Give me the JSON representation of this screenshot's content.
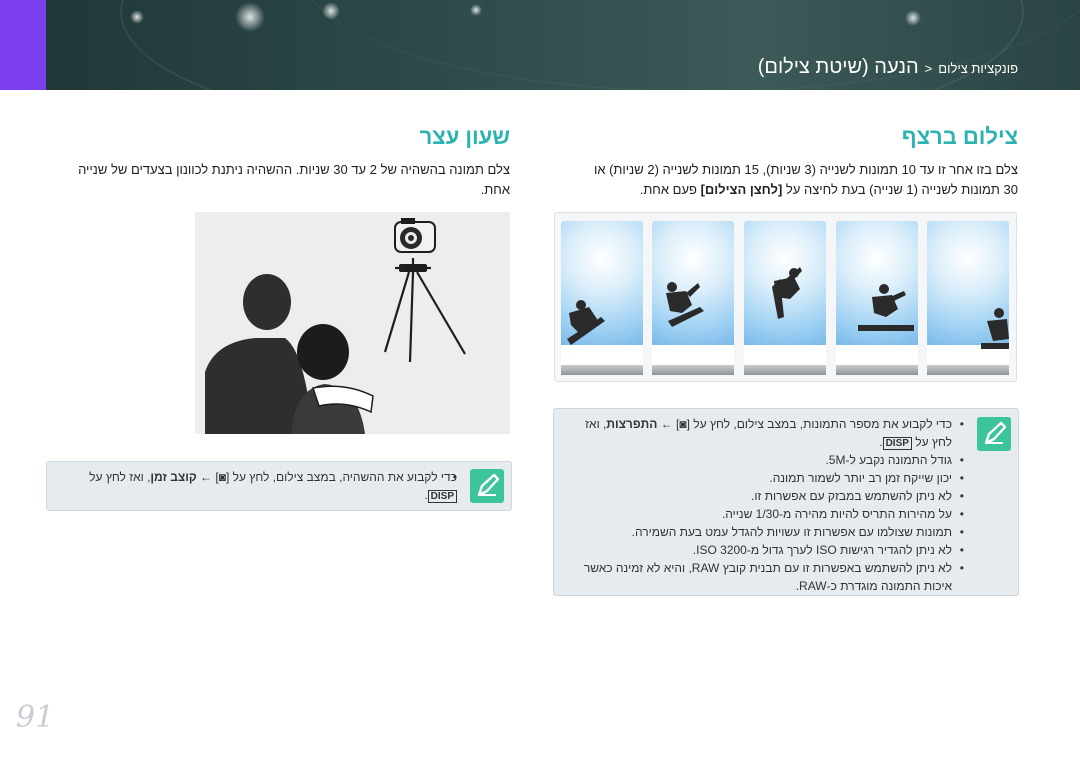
{
  "header": {
    "breadcrumb_section": "פונקציות צילום",
    "breadcrumb_separator": "<",
    "breadcrumb_page": "הנעה (שיטת צילום)"
  },
  "right_column": {
    "title": "צילום ברצף",
    "description_line1": "צלם בזו אחר זו עד 10 תמונות לשנייה (3 שניות), 15 תמונות לשנייה (2 שניות) או",
    "description_line2_a": "30 תמונות לשנייה (1 שנייה) בעת לחיצה על ",
    "description_line2_bold": "[לחצן הצילום]",
    "description_line2_b": " פעם אחת.",
    "note": {
      "icon": "pencil-icon",
      "line1_a": "כדי לקבוע את מספר התמונות, במצב צילום, לחץ על [",
      "line1_b": "] ← ",
      "line1_bold": "התפרצות",
      "line1_c": ", ואז",
      "line2_a": "לחץ על ",
      "line2_disp": "DISP",
      "line2_b": ".",
      "bullets": [
        "גודל התמונה נקבע ל-5M.",
        "יכון שייקח זמן רב יותר לשמור תמונה.",
        "לא ניתן להשתמש במבזק עם אפשרות זו.",
        "על מהירות התריס להיות מהירה מ-1/30 שנייה.",
        "תמונות שצולמו עם אפשרות זו עשויות להגדל עמט בעת השמירה.",
        "לא ניתן להגדיר רגישות ISO לערך גדול מ-3200 ISO.",
        "לא ניתן להשתמש באפשרות זו עם תבנית קובץ RAW, והיא לא זמינה כאשר איכות התמונה מוגדרת כ-RAW."
      ]
    }
  },
  "left_column": {
    "title": "שעון עצר",
    "description_line1": "צלם תמונה בהשהיה של 2 עד 30 שניות. ההשהיה ניתנת לכוונון בצעדים של שנייה",
    "description_line2": "אחת.",
    "note": {
      "icon": "pencil-icon",
      "line1_a": "כדי לקבוע את ההשהיה, במצב צילום, לחץ על [",
      "line1_b": "] ← ",
      "line1_bold": "קוצב זמן",
      "line1_c": ", ואז לחץ על",
      "line2_disp": "DISP",
      "line2_b": "."
    }
  },
  "page_number": "91",
  "colors": {
    "accent": "#7b3ff0",
    "heading": "#2ab3b0",
    "note_icon_bg": "#3cc59a",
    "note_bg": "#e6ebef"
  }
}
